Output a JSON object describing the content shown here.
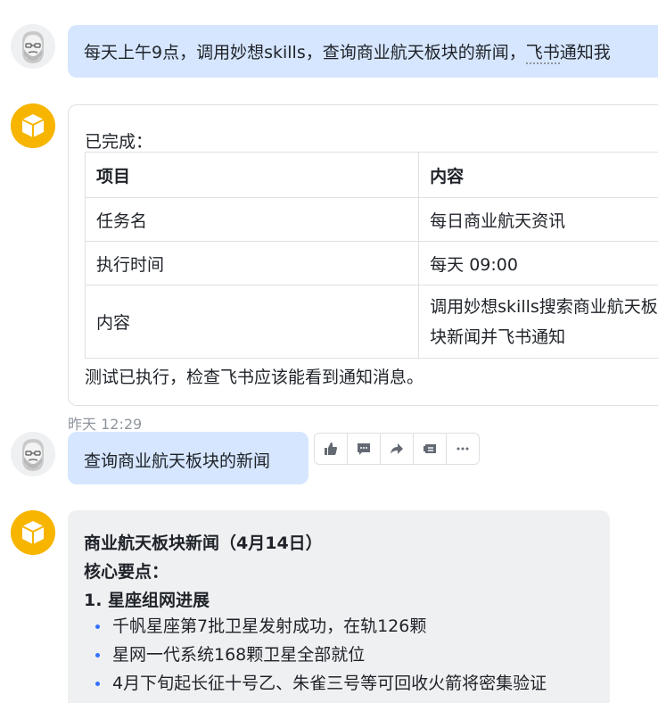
{
  "conversation": {
    "msg1": {
      "text_main": "每天上午9点，调用妙想skills，查询商业航天板块的新闻，",
      "text_underlined": "飞书",
      "text_tail": "通知我"
    },
    "card1": {
      "done_label": "已完成：",
      "table": {
        "headers": [
          "项目",
          "内容"
        ],
        "rows": [
          [
            "任务名",
            "每日商业航天资讯"
          ],
          [
            "执行时间",
            "每天 09:00"
          ],
          [
            "内容",
            "调用妙想skills搜索商业航天板块新闻并飞书通知"
          ]
        ]
      },
      "note": "测试已执行，检查飞书应该能看到通知消息。"
    },
    "timestamp": "昨天 12:29",
    "msg2": {
      "text": "查询商业航天板块的新闻"
    },
    "toolbar": {
      "icons": [
        "thumbs-up-icon",
        "comment-icon",
        "share-icon",
        "card-icon",
        "more-icon"
      ]
    },
    "card2": {
      "title": "商业航天板块新闻（4月14日）",
      "core": "核心要点：",
      "section1": "1. 星座组网进展",
      "bullets": [
        "千帆星座第7批卫星发射成功，在轨126颗",
        "星网一代系统168颗卫星全部就位",
        "4月下旬起长征十号乙、朱雀三号等可回收火箭将密集验证"
      ]
    }
  },
  "colors": {
    "user_bubble": "#d6e6ff",
    "bot_avatar": "#f7b500",
    "bullet": "#3370ff"
  }
}
